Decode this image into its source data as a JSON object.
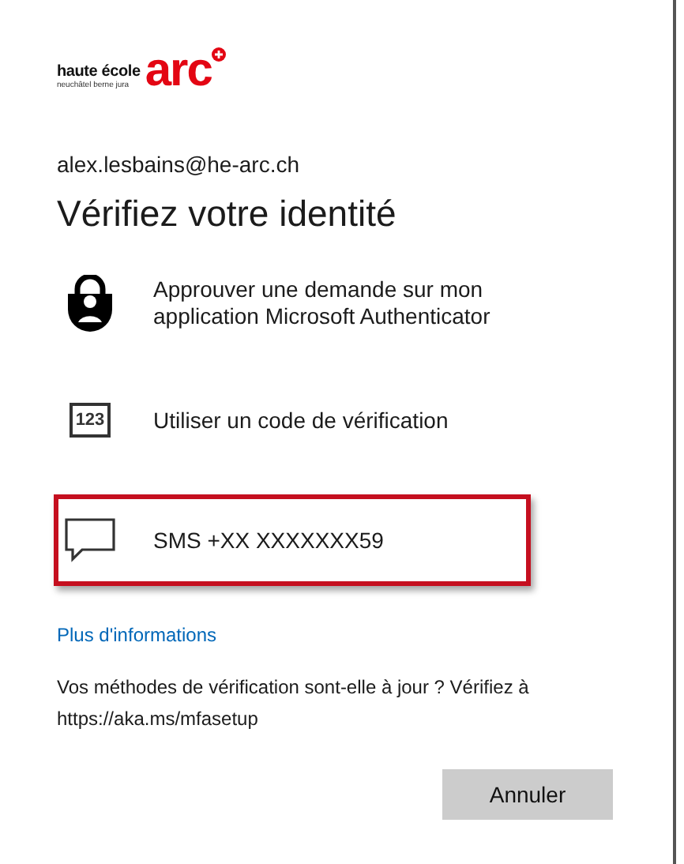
{
  "logo": {
    "school": "haute école",
    "region": "neuchâtel berne jura",
    "brand": "arc"
  },
  "account": "alex.lesbains@he-arc.ch",
  "title": "Vérifiez votre identité",
  "options": [
    {
      "kind": "authenticator",
      "label": "Approuver une demande sur mon application Microsoft Authenticator",
      "highlighted": false
    },
    {
      "kind": "code",
      "icon_text": "123",
      "label": "Utiliser un code de vérification",
      "highlighted": false
    },
    {
      "kind": "sms",
      "label": "SMS +XX XXXXXXX59",
      "highlighted": true
    }
  ],
  "more_link": "Plus d'informations",
  "notice": "Vos méthodes de vérification sont-elle à jour ? Vérifiez à https://aka.ms/mfasetup",
  "buttons": [
    "Annuler"
  ]
}
